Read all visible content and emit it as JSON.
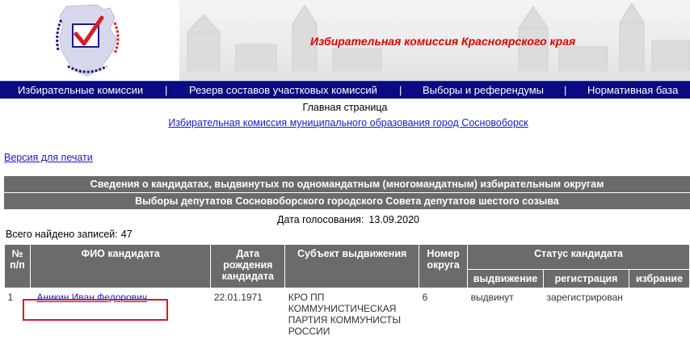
{
  "header": {
    "title": "Избирательная комиссия Красноярского края",
    "logo_alt": "Избирательная комиссия Красноярского края"
  },
  "nav": {
    "items": [
      {
        "label": "Избирательные комиссии"
      },
      {
        "label": "Резерв составов участковых комиссий"
      },
      {
        "label": "Выборы и референдумы"
      },
      {
        "label": "Нормативная база"
      }
    ],
    "separator": "|"
  },
  "breadcrumb": {
    "home": "Главная страница",
    "commission": "Избирательная комиссия муниципального образования город Сосновоборск"
  },
  "print_link": "Версия для печати",
  "banners": {
    "line1": "Сведения о кандидатах, выдвинутых по одномандатным (многомандатным) избирательным округам",
    "line2": "Выборы депутатов Сосновоборского городского Совета депутатов шестого созыва"
  },
  "vote_date": {
    "label": "Дата голосования:",
    "value": "13.09.2020"
  },
  "total": {
    "label": "Всего найдено записей:",
    "value": "47"
  },
  "table": {
    "headers": {
      "num": "№ п/п",
      "name": "ФИО кандидата",
      "dob": "Дата рождения кандидата",
      "subject": "Субъект выдвижения",
      "district": "Номер округа",
      "status": "Статус кандидата",
      "nomination": "выдвижение",
      "registration": "регистрация",
      "election": "избрание"
    },
    "rows": [
      {
        "num": "1",
        "name": "Аникин Иван Федорович",
        "dob": "22.01.1971",
        "subject": "КРО ПП КОММУНИСТИЧЕСКАЯ ПАРТИЯ КОММУНИСТЫ РОССИИ",
        "district": "6",
        "nomination": "выдвинут",
        "registration": "зарегистрирован",
        "election": ""
      }
    ]
  },
  "colors": {
    "nav_bg": "#0a0a82",
    "banner_bg": "#6b6b6b",
    "title_red": "#e00000",
    "highlight": "#d51c2c",
    "link": "#1a1acc"
  }
}
